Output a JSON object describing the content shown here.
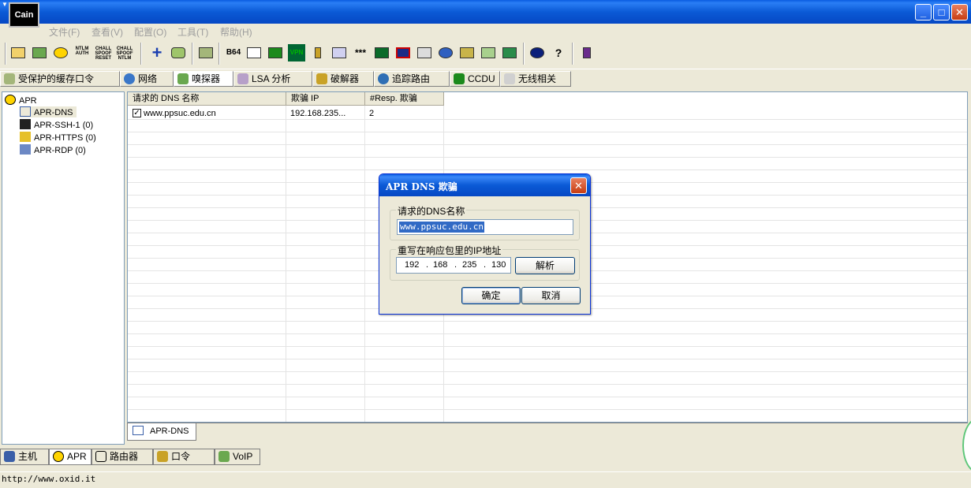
{
  "window": {
    "sysmenu_glyph": "▼",
    "logo_text": "Cain",
    "minimize": "_",
    "maximize": "□",
    "close": "✕"
  },
  "menu": [
    "文件(F)",
    "查看(V)",
    "配置(O)",
    "工具(T)",
    "帮助(H)"
  ],
  "toolbar": {
    "ntlm_auth": "NTLM AUTH",
    "chall_spoof_reset": "CHALL SPOOF RESET",
    "chall_spoof_ntlm": "CHALL SPOOF NTLM",
    "b64": "B64",
    "vpn": "VPN",
    "stars": "***"
  },
  "tabs": [
    "受保护的缓存口令",
    "网络",
    "嗅探器",
    "LSA 分析",
    "破解器",
    "追踪路由",
    "CCDU",
    "无线相关"
  ],
  "tree": {
    "root": "APR",
    "items": [
      "APR-DNS",
      "APR-SSH-1 (0)",
      "APR-HTTPS (0)",
      "APR-RDP (0)"
    ]
  },
  "list": {
    "columns": [
      "请求的 DNS 名称",
      "欺骗 IP",
      "#Resp. 欺骗"
    ],
    "rows": [
      {
        "checked": "✓",
        "name": "www.ppsuc.edu.cn",
        "ip": "192.168.235...",
        "resp": "2"
      }
    ]
  },
  "subtab": "APR-DNS",
  "bottom_tabs": [
    "主机",
    "APR",
    "路由器",
    "口令",
    "VoIP"
  ],
  "status": "http://www.oxid.it",
  "dialog": {
    "title": "APR DNS 欺骗",
    "close": "✕",
    "dns_group_label": "请求的DNS名称",
    "dns_value": "www.ppsuc.edu.cn",
    "ip_group_label": "重写在响应包里的IP地址",
    "ip_octets": [
      "192",
      "168",
      "235",
      "130"
    ],
    "resolve_button": "解析",
    "ok_button": "确定",
    "cancel_button": "取消"
  }
}
